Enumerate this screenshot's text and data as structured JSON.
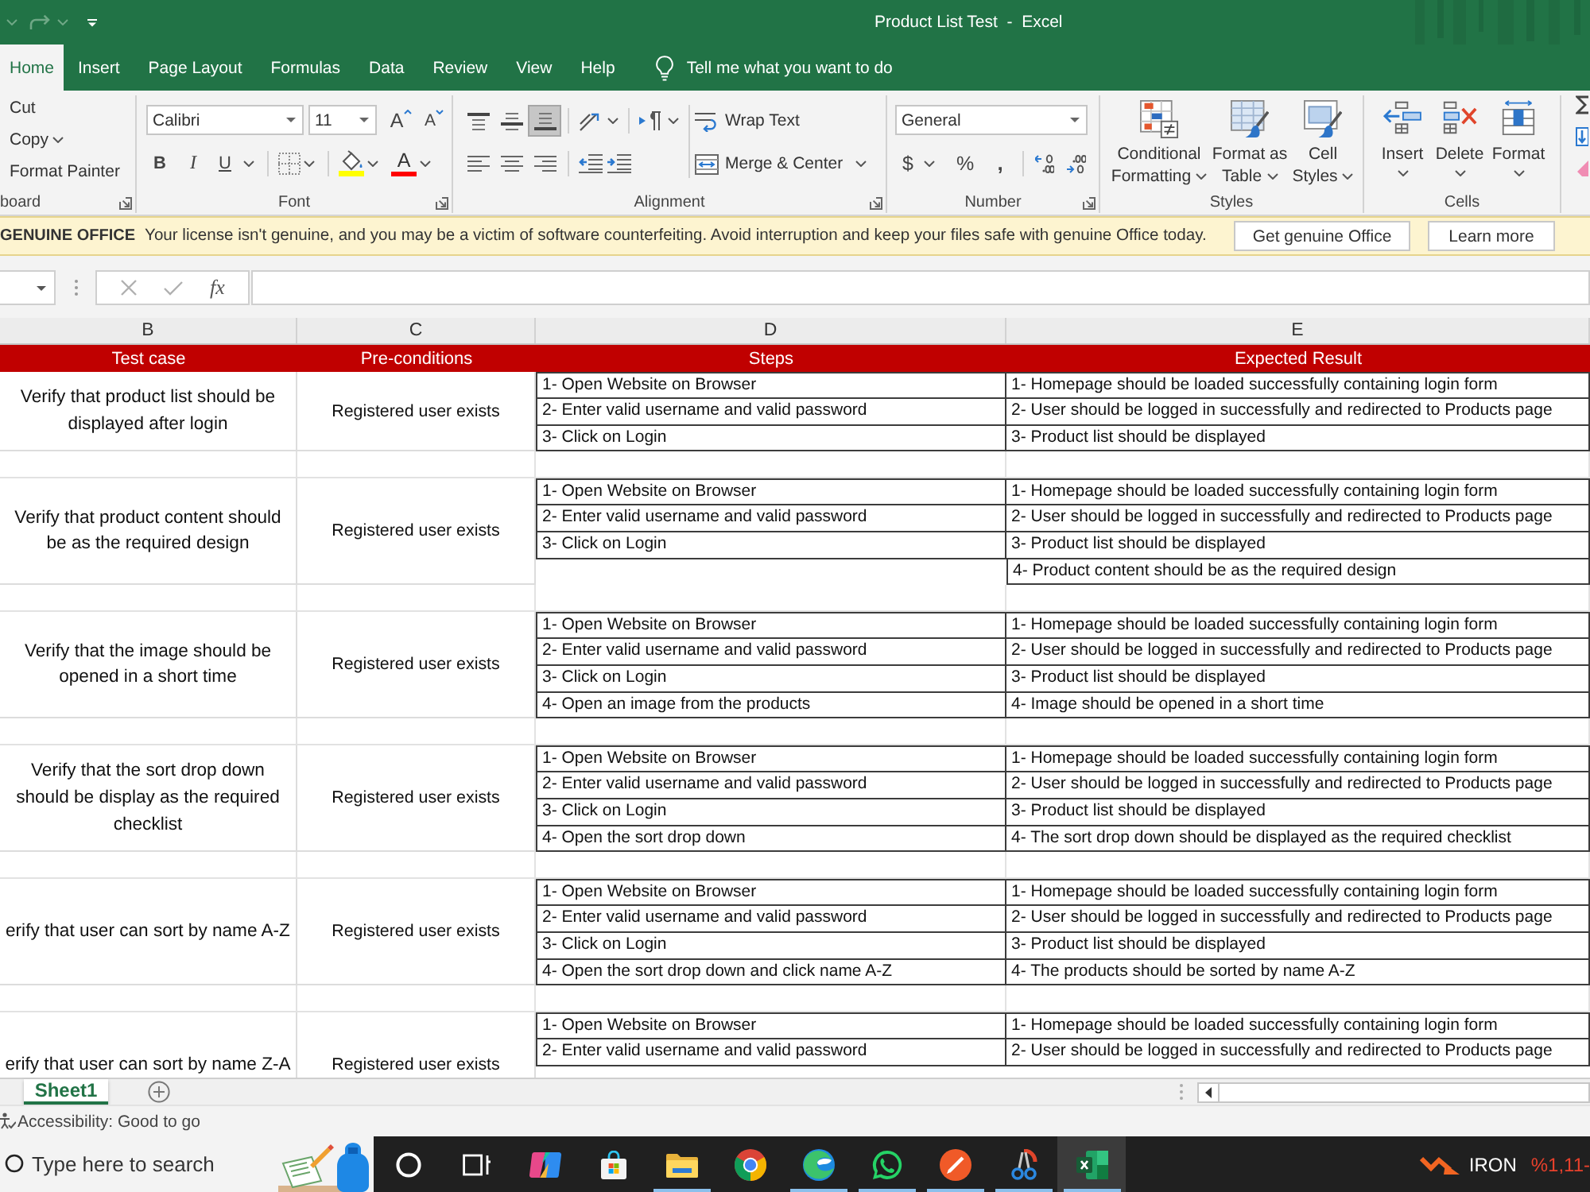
{
  "window": {
    "title": "Product List Test  -  Excel"
  },
  "ribbon_tabs": [
    {
      "label": "Home",
      "selected": true
    },
    {
      "label": "Insert",
      "selected": false
    },
    {
      "label": "Page Layout",
      "selected": false
    },
    {
      "label": "Formulas",
      "selected": false
    },
    {
      "label": "Data",
      "selected": false
    },
    {
      "label": "Review",
      "selected": false
    },
    {
      "label": "View",
      "selected": false
    },
    {
      "label": "Help",
      "selected": false
    }
  ],
  "tell_me": {
    "placeholder": "Tell me what you want to do"
  },
  "ribbon": {
    "clipboard": {
      "cut": "Cut",
      "copy": "Copy",
      "format_painter": "Format Painter",
      "label": "board"
    },
    "font": {
      "name": "Calibri",
      "size": "11",
      "grow": "A",
      "shrink": "A",
      "bold": "B",
      "italic": "I",
      "underline": "U",
      "font_color": "A",
      "label": "Font"
    },
    "alignment": {
      "vertical": [
        {
          "selected": false
        },
        {
          "selected": false
        },
        {
          "selected": true
        }
      ],
      "horizontal": [
        {
          "selected": false
        },
        {
          "selected": false
        },
        {
          "selected": false
        }
      ],
      "wrap_text": "Wrap Text",
      "merge": "Merge & Center",
      "label": "Alignment"
    },
    "number": {
      "format": "General",
      "currency": "$",
      "percent": "%",
      "comma": ",",
      "label": "Number"
    },
    "styles": {
      "buttons": [
        "Conditional Formatting",
        "Format as Table",
        "Cell Styles"
      ],
      "label": "Styles"
    },
    "cells": {
      "buttons": [
        "Insert",
        "Delete",
        "Format"
      ],
      "label": "Cells"
    }
  },
  "license_bar": {
    "title": "GENUINE OFFICE",
    "message": "Your license isn't genuine, and you may be a victim of software counterfeiting. Avoid interruption and keep your files safe with genuine Office today.",
    "buttons": [
      "Get genuine Office",
      "Learn more"
    ]
  },
  "formula_bar": {
    "function_label": "fx"
  },
  "sheet": {
    "columns": [
      "B",
      "C",
      "D",
      "E"
    ],
    "header": [
      "Test case",
      "Pre-conditions",
      "Steps",
      "Expected Result"
    ],
    "test_cases": [
      {
        "title": "Verify that product list should be displayed after login",
        "precondition": "Registered user exists",
        "steps": [
          "1- Open Website on Browser",
          "2- Enter valid username and valid password",
          "3- Click on Login"
        ],
        "expected": [
          "1- Homepage should be loaded successfully containing login form",
          "2- User should be logged in successfully and redirected to Products page",
          "3- Product list should be displayed"
        ],
        "continues": false
      },
      {
        "title": "Verify that product content should be as the required design",
        "precondition": "Registered user exists",
        "steps": [
          "1- Open Website on Browser",
          "2- Enter valid username and valid password",
          "3- Click on Login"
        ],
        "expected": [
          "1- Homepage should be loaded successfully containing login form",
          "2- User should be logged in successfully and redirected to Products page",
          "3- Product list should be displayed",
          "4- Product content should be as the required design"
        ],
        "continues": false
      },
      {
        "title": "Verify that the image should be opened in a short time",
        "precondition": "Registered user exists",
        "steps": [
          "1- Open Website on Browser",
          "2- Enter valid username and valid password",
          "3- Click on Login",
          "4- Open an image from the products"
        ],
        "expected": [
          "1- Homepage should be loaded successfully containing login form",
          "2- User should be logged in successfully and redirected to Products page",
          "3- Product list should be displayed",
          "4- Image should be opened in a short time"
        ],
        "continues": false
      },
      {
        "title": "Verify that the sort drop down should be display as the required checklist",
        "precondition": "Registered user exists",
        "steps": [
          "1- Open Website on Browser",
          "2- Enter valid username and valid password",
          "3- Click on Login",
          "4- Open the sort drop down"
        ],
        "expected": [
          "1- Homepage should be loaded successfully containing login form",
          "2- User should be logged in successfully and redirected to Products page",
          "3- Product list should be displayed",
          "4- The sort drop down should be displayed as the required checklist"
        ],
        "continues": false
      },
      {
        "title": "erify that user can sort by name A-Z",
        "precondition": "Registered user exists",
        "steps": [
          "1- Open Website on Browser",
          "2- Enter valid username and valid password",
          "3- Click on Login",
          "4- Open the sort drop down and click name A-Z"
        ],
        "expected": [
          "1- Homepage should be loaded successfully containing login form",
          "2- User should be logged in successfully and redirected to Products page",
          "3- Product list should be displayed",
          "4- The products should be sorted by name A-Z"
        ],
        "continues": false
      },
      {
        "title": "erify that user can sort by name Z-A",
        "precondition": "Registered user exists",
        "steps": [
          "1- Open Website on Browser",
          "2- Enter valid username and valid password"
        ],
        "expected": [
          "1- Homepage should be loaded successfully containing login form",
          "2- User should be logged in successfully and redirected to Products page"
        ],
        "continues": true
      }
    ]
  },
  "sheet_tabs": [
    {
      "label": "Sheet1",
      "selected": true
    }
  ],
  "status_bar": {
    "accessibility": "Accessibility: Good to go"
  },
  "taskbar": {
    "search": {
      "placeholder": "Type here to search"
    },
    "apps": [
      {
        "kind": "blob",
        "running": false,
        "selected": false
      },
      {
        "kind": "bag",
        "running": false,
        "selected": false
      },
      {
        "kind": "folder",
        "running": true,
        "selected": false
      },
      {
        "kind": "browser",
        "running": false,
        "selected": false
      },
      {
        "kind": "swirl",
        "running": true,
        "selected": false
      },
      {
        "kind": "chat",
        "running": true,
        "selected": false
      },
      {
        "kind": "pen",
        "running": true,
        "selected": false
      },
      {
        "kind": "scissors",
        "running": true,
        "selected": false
      },
      {
        "kind": "sheet",
        "running": true,
        "selected": true
      }
    ],
    "ticker": {
      "symbol": "IRON",
      "change": "%1,11-"
    }
  }
}
